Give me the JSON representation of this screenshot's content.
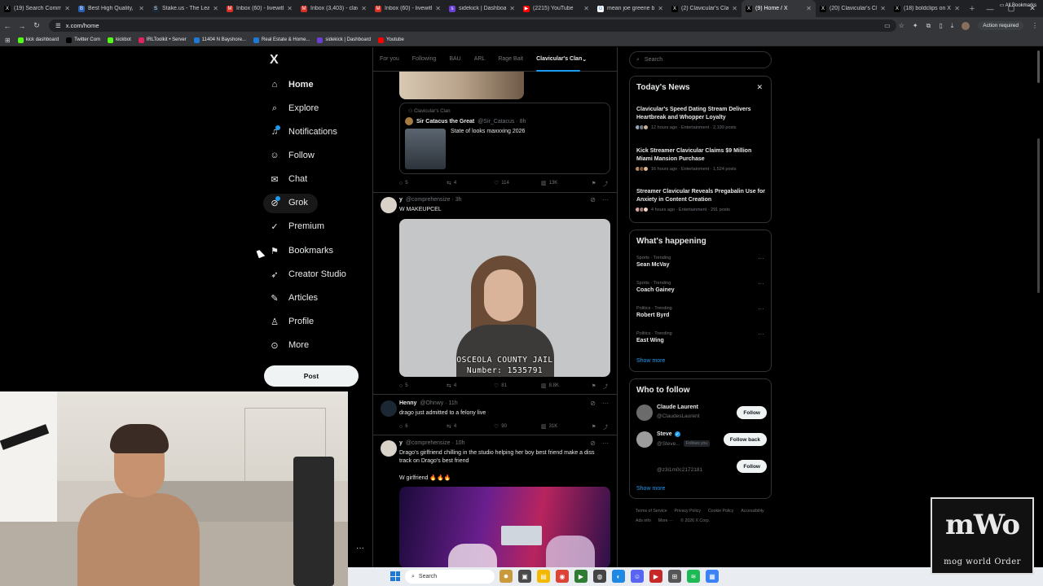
{
  "browser": {
    "tabs": [
      {
        "title": "(19) Search Commu",
        "color": "#000000",
        "glyph": "X"
      },
      {
        "title": "Best High Quality, S",
        "color": "#2b5fb3",
        "glyph": "B"
      },
      {
        "title": "Stake.us - The Lead",
        "color": "#1a2c38",
        "glyph": "S"
      },
      {
        "title": "Inbox (60) - livewith",
        "color": "#d93025",
        "glyph": "M"
      },
      {
        "title": "Inbox (3,403) - clavi",
        "color": "#d93025",
        "glyph": "M"
      },
      {
        "title": "Inbox (60) - livewith",
        "color": "#d93025",
        "glyph": "M"
      },
      {
        "title": "sidekick | Dashboard",
        "color": "#6b3fd6",
        "glyph": "s"
      },
      {
        "title": "(2215) YouTube",
        "color": "#ff0000",
        "glyph": "▶"
      },
      {
        "title": "mean joe greene b",
        "color": "#ffffff",
        "glyph": "G"
      },
      {
        "title": "(2) Clavicular's Clan",
        "color": "#000000",
        "glyph": "X"
      },
      {
        "title": "(9) Home / X",
        "color": "#000000",
        "glyph": "X",
        "active": true
      },
      {
        "title": "(20) Clavicular's Cla",
        "color": "#000000",
        "glyph": "X"
      },
      {
        "title": "(18) boldclips on X",
        "color": "#000000",
        "glyph": "X"
      }
    ],
    "new_tab": "+",
    "url": "x.com/home",
    "action_required": "Action required",
    "all_bookmarks": "All Bookmarks",
    "bookmarks": [
      {
        "label": "kick dashboard",
        "color": "#53fc18"
      },
      {
        "label": "Twitter Com",
        "color": "#000000"
      },
      {
        "label": "kickbot",
        "color": "#53fc18"
      },
      {
        "label": "IRLToolkit • Server",
        "color": "#e0245e"
      },
      {
        "label": "11404 N Bayshore...",
        "color": "#1e78d6"
      },
      {
        "label": "Real Estate & Home...",
        "color": "#1e78d6"
      },
      {
        "label": "sidekick | Dashboard",
        "color": "#6b3fd6"
      },
      {
        "label": "Youtube",
        "color": "#ff0000"
      }
    ]
  },
  "leftnav": {
    "logo": "X",
    "items": [
      {
        "label": "Home",
        "icon": "home-icon",
        "glyph": "⌂",
        "bold": true
      },
      {
        "label": "Explore",
        "icon": "search-icon",
        "glyph": "⌕"
      },
      {
        "label": "Notifications",
        "icon": "bell-icon",
        "glyph": "♫"
      },
      {
        "label": "Follow",
        "icon": "person-plus-icon",
        "glyph": "☺"
      },
      {
        "label": "Chat",
        "icon": "mail-icon",
        "glyph": "✉"
      },
      {
        "label": "Grok",
        "icon": "grok-icon",
        "glyph": "⊘"
      },
      {
        "label": "Premium",
        "icon": "premium-icon",
        "glyph": "✓"
      },
      {
        "label": "Bookmarks",
        "icon": "bookmark-icon",
        "glyph": "⚑"
      },
      {
        "label": "Creator Studio",
        "icon": "rocket-icon",
        "glyph": "➶"
      },
      {
        "label": "Articles",
        "icon": "article-icon",
        "glyph": "✎"
      },
      {
        "label": "Profile",
        "icon": "profile-icon",
        "glyph": "♙"
      },
      {
        "label": "More",
        "icon": "more-circle-icon",
        "glyph": "⊙"
      }
    ],
    "post_button": "Post"
  },
  "feed": {
    "tabs": [
      "For you",
      "Following",
      "BAU",
      "ARL",
      "Rage Bait",
      "Clavicular's Clan"
    ],
    "quote": {
      "community": "Clavicular's Clan",
      "name": "Sir Catacus the Great",
      "handle": "@Sir_Catacus · 8h",
      "text": "State of looks maxxxing 2026"
    },
    "post0_actions": [
      "5",
      "4",
      "114",
      "13K"
    ],
    "posts": [
      {
        "name": "y",
        "handle": "@comprehensize · 3h",
        "text": "W MAKEUPCEL",
        "actions": [
          "5",
          "4",
          "81",
          "8.8K"
        ]
      },
      {
        "name": "Henny",
        "handle": "@Ohnwy · 11h",
        "text": "drago just admitted to a felony live",
        "actions": [
          "6",
          "4",
          "90",
          "31K"
        ]
      },
      {
        "name": "y",
        "handle": "@comprehensize · 10h",
        "text": "Drago's girlfriend chilling in the studio helping her boy best friend make a diss track on Drago's best friend",
        "text2": "W girlfriend 🔥🔥🔥"
      }
    ],
    "mugshot_caption1": "OSCEOLA COUNTY JAIL",
    "mugshot_caption2": "Number: 1535791"
  },
  "sidebar": {
    "search_placeholder": "Search",
    "news_title": "Today's News",
    "news": [
      {
        "headline": "Clavicular's Speed Dating Stream Delivers Heartbreak and Whopper Loyalty",
        "meta": "12 hours ago · Entertainment · 2,199 posts"
      },
      {
        "headline": "Kick Streamer Clavicular Claims $9 Million Miami Mansion Purchase",
        "meta": "16 hours ago · Entertainment · 1,524 posts"
      },
      {
        "headline": "Streamer Clavicular Reveals Pregabalin Use for Anxiety in Content Creation",
        "meta": "4 hours ago · Entertainment · 291 posts"
      }
    ],
    "happening_title": "What's happening",
    "trends": [
      {
        "category": "Sports · Trending",
        "name": "Sean McVay"
      },
      {
        "category": "Sports · Trending",
        "name": "Coach Gainey"
      },
      {
        "category": "Politics · Trending",
        "name": "Robert Byrd"
      },
      {
        "category": "Politics · Trending",
        "name": "East Wing"
      }
    ],
    "show_more": "Show more",
    "who_title": "Who to follow",
    "who": [
      {
        "name": "Claude Laurent",
        "handle": "@ClaudesLaurent",
        "button": "Follow"
      },
      {
        "name": "Steve",
        "handle": "@Steve...",
        "follows_you": "Follows you",
        "button": "Follow back"
      },
      {
        "name": "",
        "handle": "@z3i1m0c2172181",
        "button": "Follow"
      }
    ],
    "footer": [
      "Terms of Service",
      "Privacy Policy",
      "Cookie Policy",
      "Accessibility",
      "Ads info",
      "More ···",
      "© 2026 X Corp."
    ]
  },
  "taskbar": {
    "search": "Search"
  },
  "watermark": {
    "big": "mWo",
    "small": "mog world Order"
  }
}
